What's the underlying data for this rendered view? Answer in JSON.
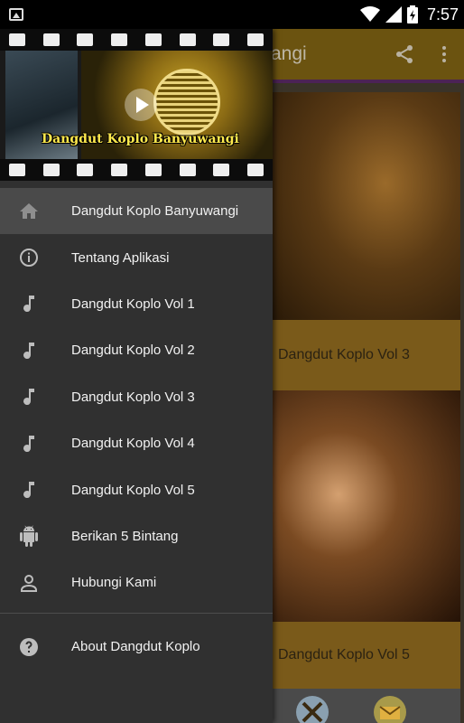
{
  "status_bar": {
    "time": "7:57"
  },
  "app": {
    "title": "angi",
    "cards": [
      {
        "label": "Dangdut Koplo Vol 3"
      },
      {
        "label": "Dangdut Koplo Vol 5"
      }
    ]
  },
  "drawer": {
    "header": {
      "title": "Dangdut Koplo Banyuwangi"
    },
    "items": [
      {
        "label": "Dangdut Koplo Banyuwangi",
        "icon": "home-icon",
        "selected": true
      },
      {
        "label": "Tentang Aplikasi",
        "icon": "info-icon"
      },
      {
        "label": "Dangdut Koplo Vol 1",
        "icon": "music-note-icon"
      },
      {
        "label": "Dangdut Koplo Vol 2",
        "icon": "music-note-icon"
      },
      {
        "label": "Dangdut Koplo Vol 3",
        "icon": "music-note-icon"
      },
      {
        "label": "Dangdut Koplo Vol 4",
        "icon": "music-note-icon"
      },
      {
        "label": "Dangdut Koplo Vol 5",
        "icon": "music-note-icon"
      },
      {
        "label": "Berikan 5 Bintang",
        "icon": "android-icon"
      },
      {
        "label": "Hubungi Kami",
        "icon": "person-icon"
      }
    ],
    "about": {
      "label": "About Dangdut Koplo",
      "icon": "help-icon"
    }
  },
  "colors": {
    "drawer_bg": "#303030",
    "selected_bg": "#4a4a4a",
    "app_bar": "#6b5310",
    "header_title": "#ffe94d"
  }
}
